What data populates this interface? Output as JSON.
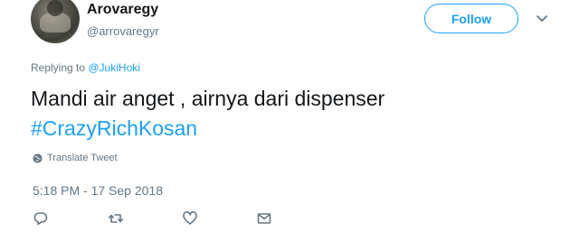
{
  "user": {
    "display_name": "Arovaregy",
    "handle": "@arrovaregyr"
  },
  "follow_label": "Follow",
  "reply": {
    "prefix": "Replying to ",
    "mention": "@JukiHoki"
  },
  "tweet": {
    "text_line1": "Mandi air anget , airnya dari dispenser",
    "hashtag": "#CrazyRichKosan"
  },
  "translate_label": "Translate Tweet",
  "timestamp": "5:18 PM - 17 Sep 2018",
  "icons": {
    "avatar": "avatar",
    "caret": "chevron-down-icon",
    "globe": "globe-icon",
    "reply": "reply-icon",
    "retweet": "retweet-icon",
    "like": "heart-icon",
    "dm": "envelope-icon"
  },
  "colors": {
    "accent": "#1da1f2",
    "text": "#14171a",
    "muted": "#657786"
  }
}
